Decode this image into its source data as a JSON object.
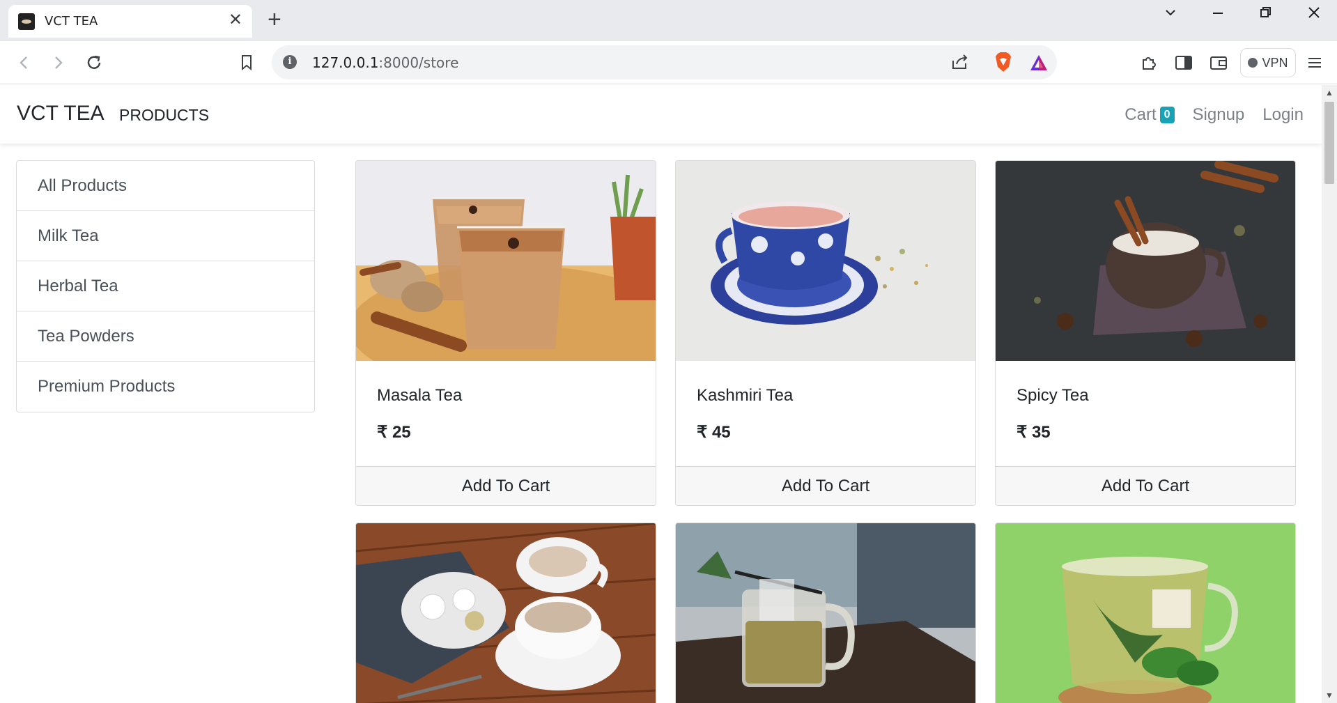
{
  "browser": {
    "tab_title": "VCT TEA",
    "url_host": "127.0.0.1",
    "url_path": ":8000/store",
    "vpn_label": "VPN"
  },
  "navbar": {
    "brand": "VCT TEA",
    "products": "PRODUCTS",
    "cart_label": "Cart",
    "cart_count": "0",
    "signup": "Signup",
    "login": "Login",
    "badge_color": "#17a2b8"
  },
  "sidebar": {
    "items": [
      {
        "label": "All Products"
      },
      {
        "label": "Milk Tea"
      },
      {
        "label": "Herbal Tea"
      },
      {
        "label": "Tea Powders"
      },
      {
        "label": "Premium Products"
      }
    ]
  },
  "products": [
    {
      "name": "Masala Tea",
      "price": "₹ 25",
      "button": "Add To Cart",
      "image": "masala-tea-glasses"
    },
    {
      "name": "Kashmiri Tea",
      "price": "₹ 45",
      "button": "Add To Cart",
      "image": "kashmiri-tea-blue-cup"
    },
    {
      "name": "Spicy Tea",
      "price": "₹ 35",
      "button": "Add To Cart",
      "image": "spicy-tea-dark-cup"
    },
    {
      "image": "milk-tea-two-cups"
    },
    {
      "image": "herbal-tea-glass-mug"
    },
    {
      "image": "green-tea-cup"
    }
  ]
}
